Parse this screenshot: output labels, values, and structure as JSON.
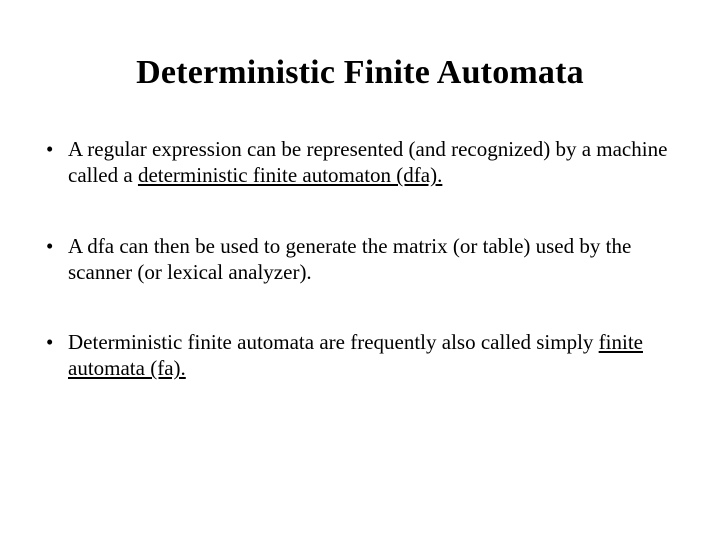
{
  "title": "Deterministic Finite Automata",
  "bullets": [
    {
      "pre": "A regular expression can be represented (and recognized) by a machine called a ",
      "underlined": "deterministic finite automaton (dfa).",
      "post": ""
    },
    {
      "pre": "A dfa can then be used to generate the matrix (or table) used by the scanner (or lexical analyzer).",
      "underlined": "",
      "post": ""
    },
    {
      "pre": "Deterministic finite automata are frequently also called simply ",
      "underlined": "finite automata (fa).",
      "post": ""
    }
  ]
}
